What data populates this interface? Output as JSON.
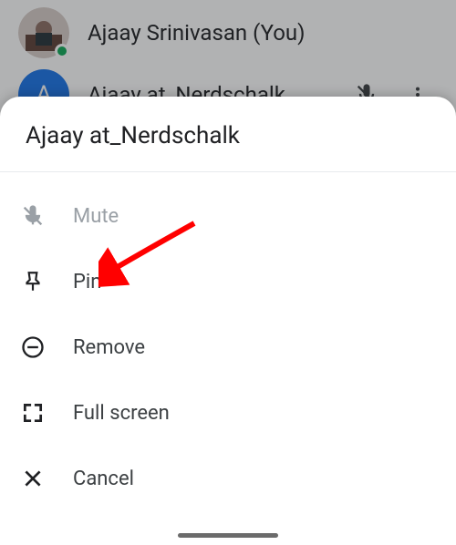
{
  "background": {
    "rows": [
      {
        "name": "Ajaay Srinivasan (You)",
        "avatar_letter": "",
        "has_photo": true,
        "presence": true
      },
      {
        "name": "Ajaay at_Nerdschalk",
        "avatar_letter": "A",
        "has_photo": false,
        "presence": false
      }
    ]
  },
  "sheet": {
    "title": "Ajaay at_Nerdschalk",
    "items": [
      {
        "label": "Mute",
        "icon": "mute-icon",
        "disabled": true
      },
      {
        "label": "Pin",
        "icon": "pin-icon",
        "disabled": false
      },
      {
        "label": "Remove",
        "icon": "remove-icon",
        "disabled": false
      },
      {
        "label": "Full screen",
        "icon": "fullscreen-icon",
        "disabled": false
      },
      {
        "label": "Cancel",
        "icon": "close-icon",
        "disabled": false
      }
    ]
  },
  "annotation": {
    "arrow_color": "#ff0000"
  }
}
